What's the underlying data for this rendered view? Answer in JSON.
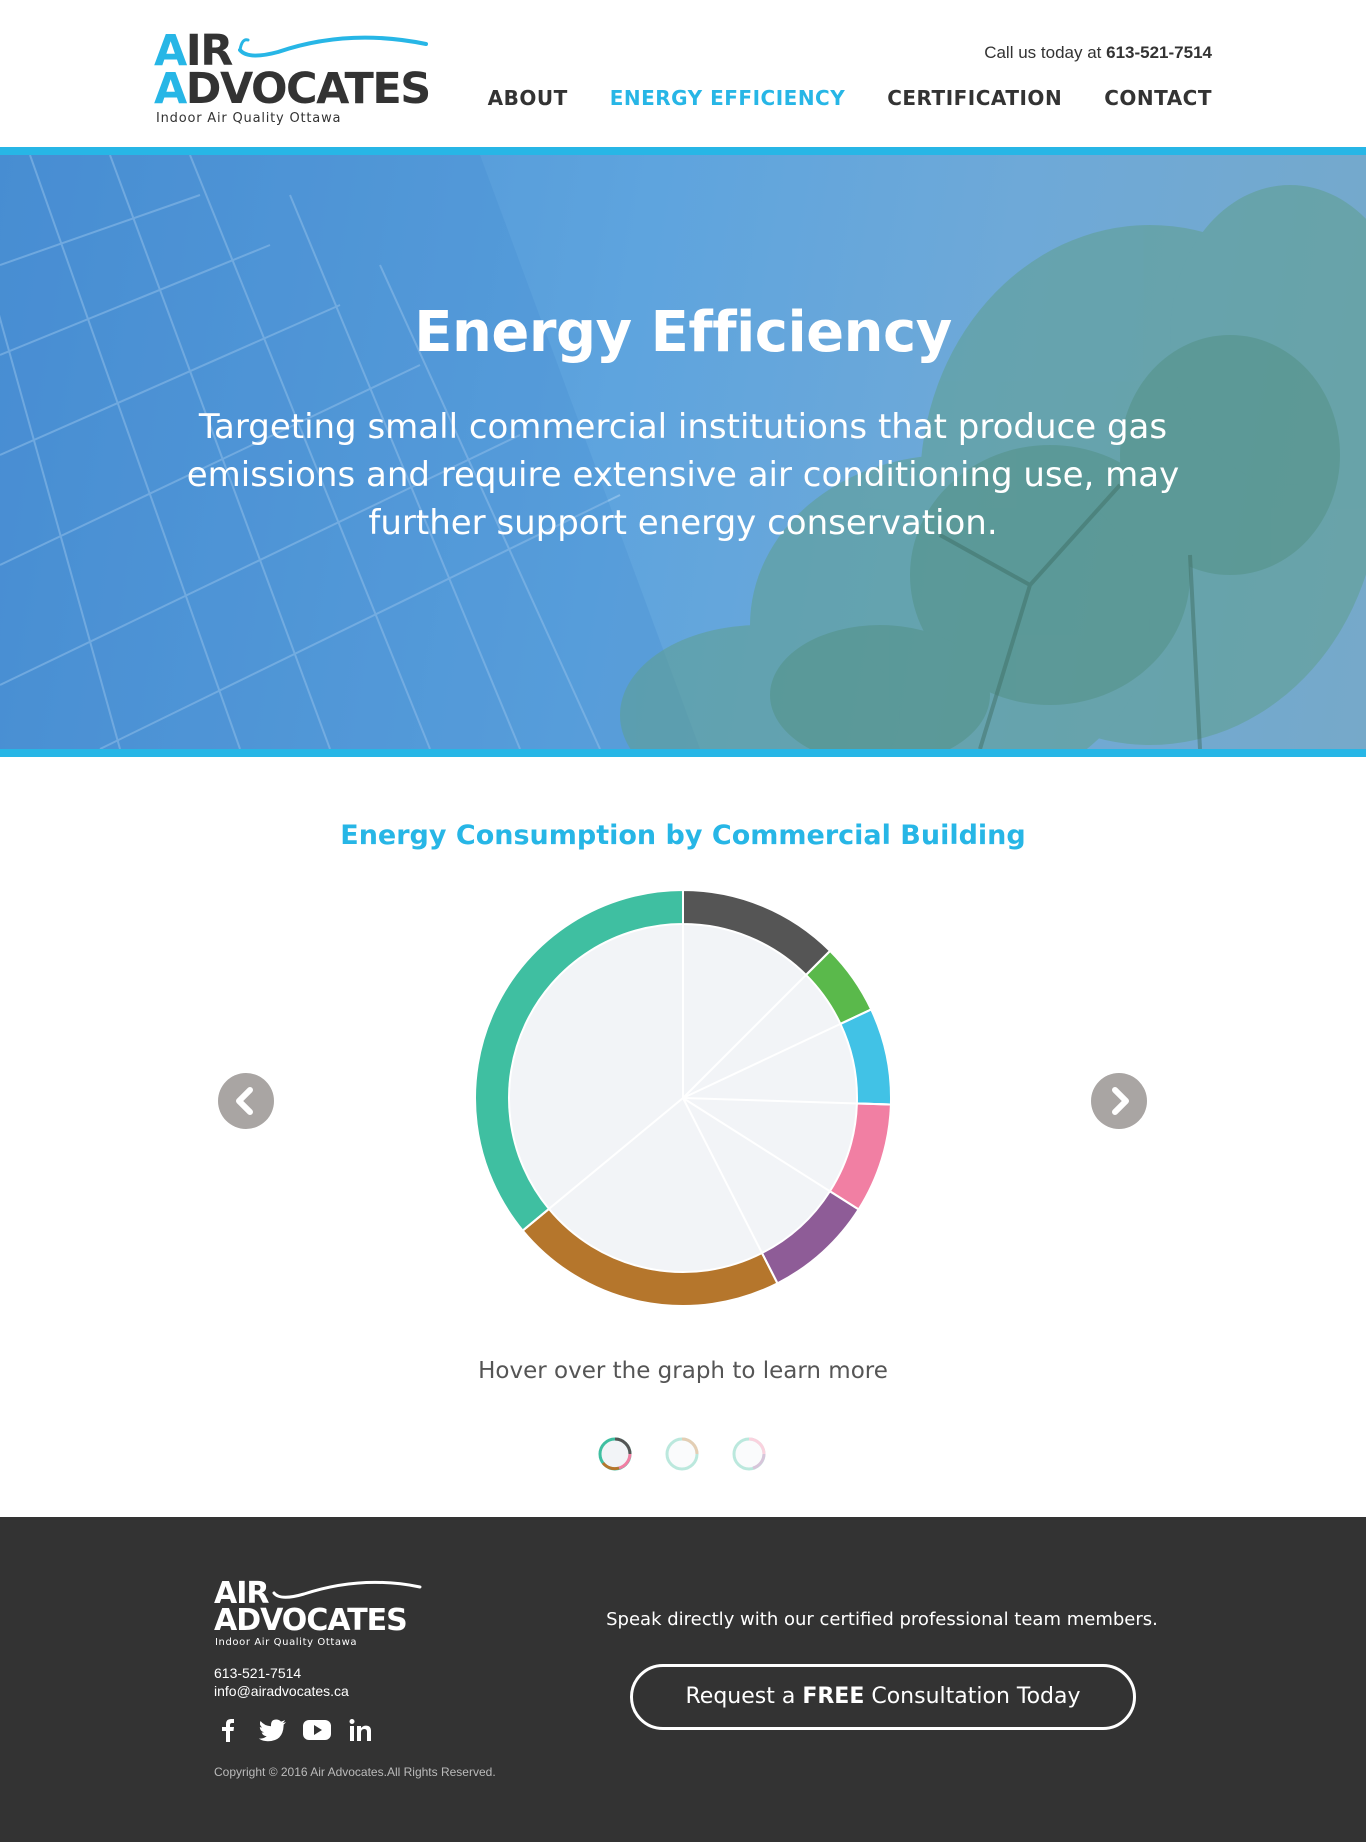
{
  "header": {
    "logo": {
      "line1_accent": "A",
      "line1_rest": "IR",
      "line2_accent": "A",
      "line2_rest": "DVOCATES",
      "tagline": "Indoor Air Quality Ottawa"
    },
    "phone_prefix": "Call us today at",
    "phone_number": "613-521-7514",
    "nav": [
      {
        "label": "ABOUT",
        "active": false
      },
      {
        "label": "ENERGY EFFICIENCY",
        "active": true
      },
      {
        "label": "CERTIFICATION",
        "active": false
      },
      {
        "label": "CONTACT",
        "active": false
      }
    ]
  },
  "hero": {
    "title": "Energy Efficiency",
    "text": "Targeting small commercial institutions that produce gas emissions and require extensive air conditioning use, may further support energy conservation."
  },
  "chart_section": {
    "title": "Energy Consumption by Commercial Building",
    "hint": "Hover over the graph to learn more",
    "prev_icon": "chevron-left-icon",
    "next_icon": "chevron-right-icon",
    "pagination": {
      "count": 3,
      "active": 0
    }
  },
  "chart_data": {
    "type": "pie",
    "title": "Energy Consumption by Commercial Building",
    "style": "donut-outline",
    "inner_fill": "#f2f4f7",
    "slices": [
      {
        "value": 12.5,
        "color": "#555555"
      },
      {
        "value": 5.5,
        "color": "#5ab94b"
      },
      {
        "value": 7.5,
        "color": "#41c2e6"
      },
      {
        "value": 8.5,
        "color": "#f17fa3"
      },
      {
        "value": 8.5,
        "color": "#8e5c97"
      },
      {
        "value": 21.5,
        "color": "#b5762c"
      },
      {
        "value": 36.0,
        "color": "#3fbfa1"
      }
    ]
  },
  "footer": {
    "logo": {
      "line1": "AIR",
      "line2": "ADVOCATES",
      "tagline": "Indoor Air Quality Ottawa"
    },
    "phone": "613-521-7514",
    "email": "info@airadvocates.ca",
    "social_icons": [
      "facebook-icon",
      "twitter-icon",
      "youtube-icon",
      "linkedin-icon"
    ],
    "copyright": "Copyright © 2016 Air Advocates.All Rights Reserved.",
    "speak_text": "Speak directly with our certified professional team members.",
    "cta": {
      "prefix": "Request a",
      "bold": "FREE",
      "suffix": "Consultation Today"
    }
  },
  "colors": {
    "accent": "#27b6e6",
    "dark": "#333333",
    "footer_bg": "#333333",
    "arrow_bg": "#a9a5a3"
  }
}
